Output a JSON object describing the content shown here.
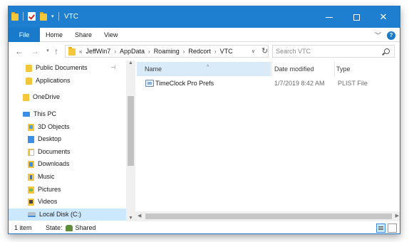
{
  "window": {
    "title": "VTC"
  },
  "ribbon": {
    "tabs": [
      "File",
      "Home",
      "Share",
      "View"
    ],
    "help_label": "?"
  },
  "address": {
    "crumbs": [
      "JeffWin7",
      "AppData",
      "Roaming",
      "Redcort",
      "VTC"
    ],
    "search_placeholder": "Search VTC"
  },
  "nav": {
    "items": [
      {
        "label": "Public Documents",
        "icon": "folder-icon",
        "pinned": true
      },
      {
        "label": "Applications",
        "icon": "folder-icon"
      },
      {
        "label": "OneDrive",
        "icon": "onedrive-icon"
      },
      {
        "label": "This PC",
        "icon": "this-pc-icon"
      },
      {
        "label": "3D Objects",
        "icon": "3d-objects-icon"
      },
      {
        "label": "Desktop",
        "icon": "desktop-icon"
      },
      {
        "label": "Documents",
        "icon": "documents-icon"
      },
      {
        "label": "Downloads",
        "icon": "downloads-icon"
      },
      {
        "label": "Music",
        "icon": "music-icon"
      },
      {
        "label": "Pictures",
        "icon": "pictures-icon"
      },
      {
        "label": "Videos",
        "icon": "videos-icon"
      },
      {
        "label": "Local Disk (C:)",
        "icon": "local-disk-icon",
        "selected": true
      }
    ]
  },
  "columns": {
    "name": "Name",
    "date": "Date modified",
    "type": "Type"
  },
  "files": [
    {
      "name": "TimeClock Pro Prefs",
      "date": "1/7/2019 8:42 AM",
      "type": "PLIST File"
    }
  ],
  "status": {
    "count": "1 item",
    "state_label": "State:",
    "state_value": "Shared"
  },
  "colors": {
    "titlebar": "#1e7fd0",
    "selected": "#cce8ff",
    "folder": "#f4c73a"
  }
}
